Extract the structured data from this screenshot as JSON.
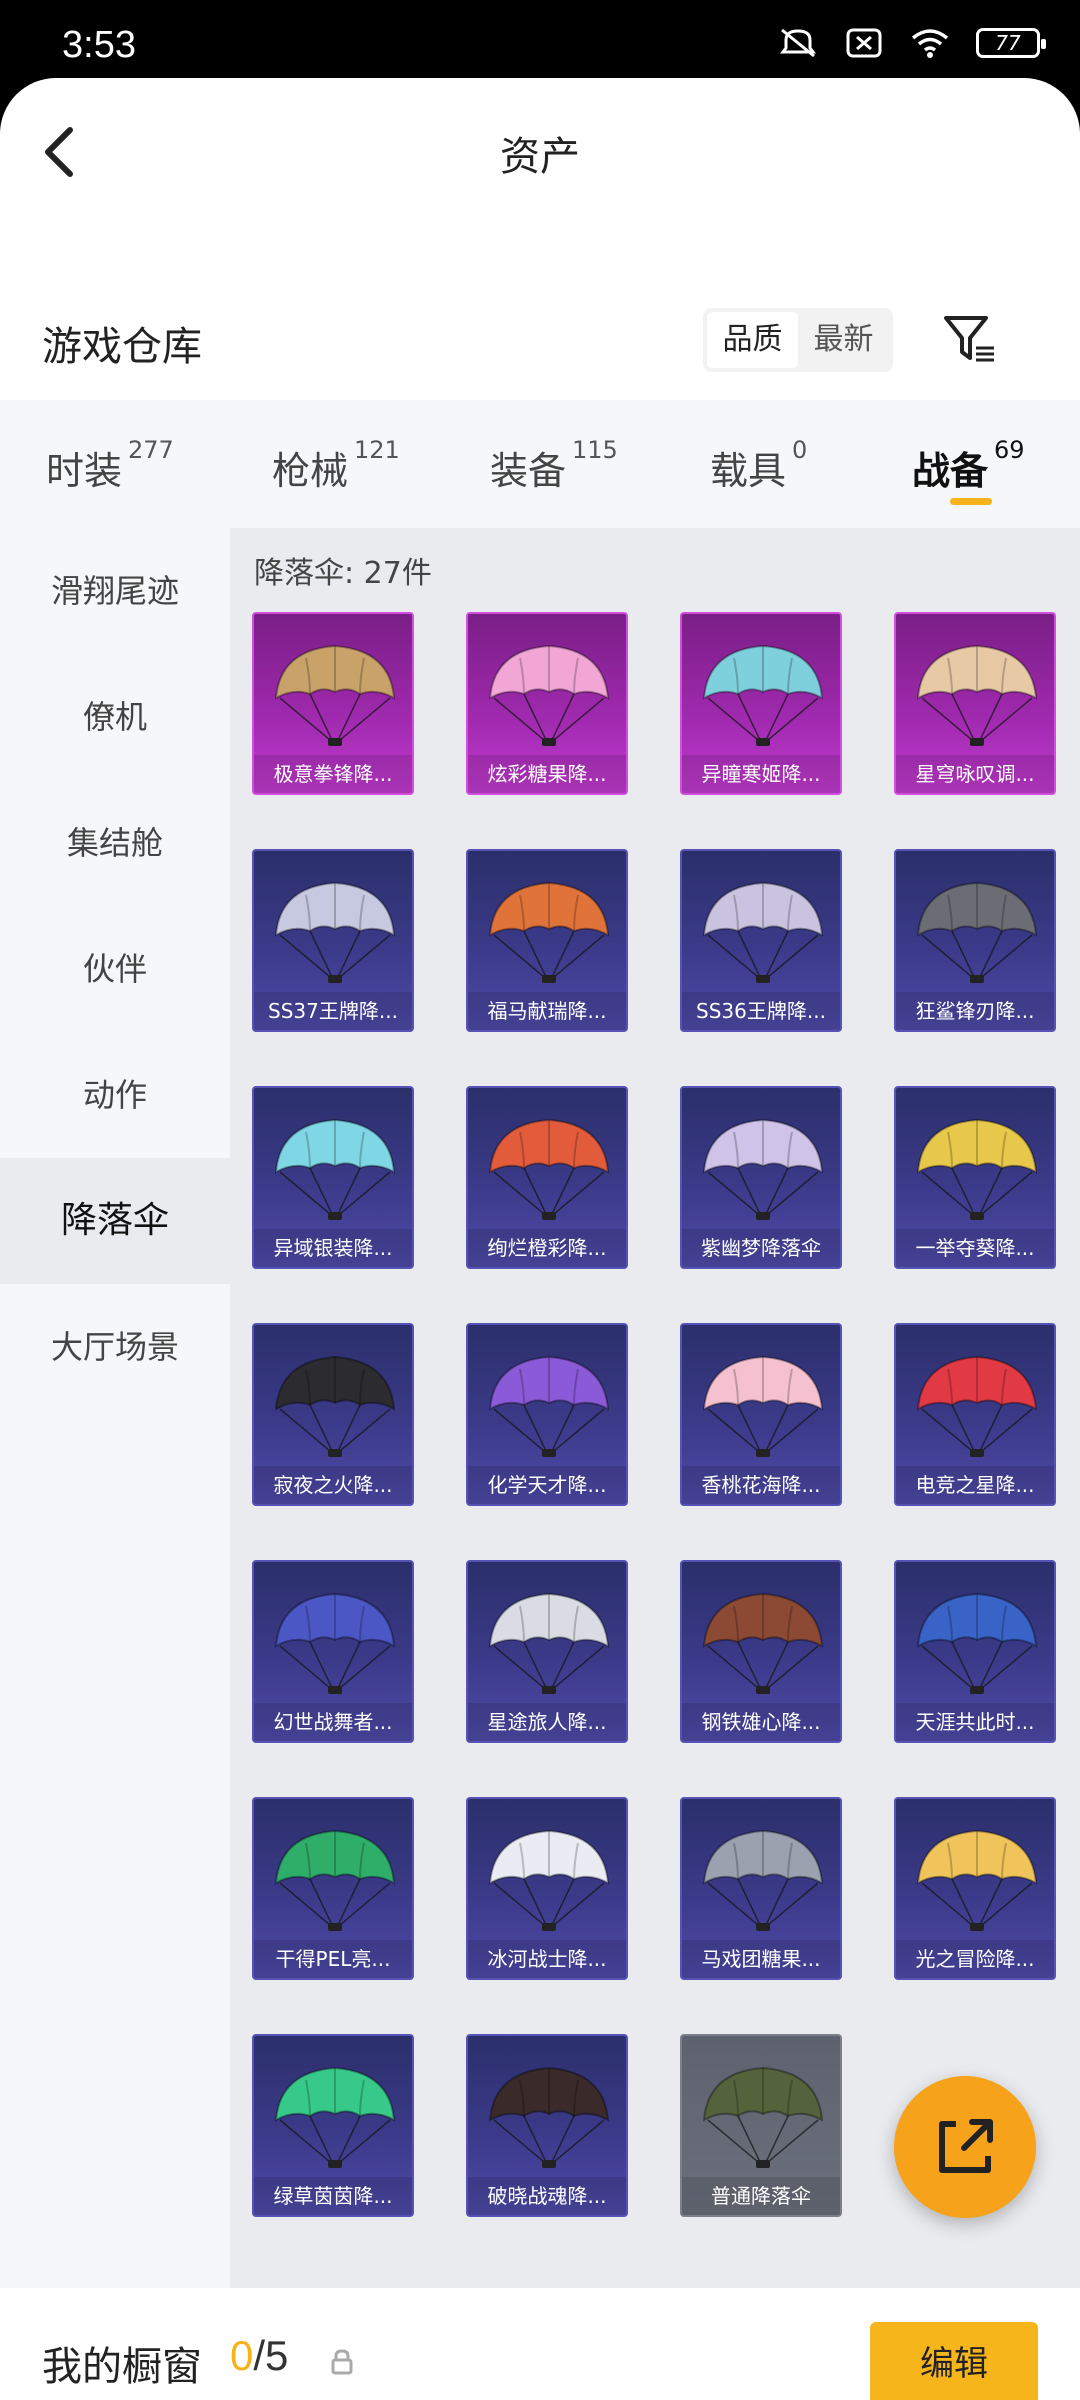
{
  "status_bar": {
    "time": "3:53",
    "battery": "77"
  },
  "header": {
    "title": "资产"
  },
  "warehouse": {
    "title": "游戏仓库",
    "sort_options": [
      "品质",
      "最新"
    ]
  },
  "tabs": [
    {
      "label": "时装",
      "count": "277"
    },
    {
      "label": "枪械",
      "count": "121"
    },
    {
      "label": "装备",
      "count": "115"
    },
    {
      "label": "载具",
      "count": "0"
    },
    {
      "label": "战备",
      "count": "69"
    }
  ],
  "side_menu": [
    "滑翔尾迹",
    "僚机",
    "集结舱",
    "伙伴",
    "动作",
    "降落伞",
    "大厅场景"
  ],
  "grid": {
    "header": "降落伞: 27件",
    "items": [
      {
        "name": "极意拳锋降...",
        "rarity": "legend",
        "color": "#c9a26a"
      },
      {
        "name": "炫彩糖果降...",
        "rarity": "legend",
        "color": "#f2a6d6"
      },
      {
        "name": "异瞳寒姬降...",
        "rarity": "legend",
        "color": "#7fd0dd"
      },
      {
        "name": "星穹咏叹调...",
        "rarity": "legend",
        "color": "#e8c9a6"
      },
      {
        "name": "SS37王牌降...",
        "rarity": "epic",
        "color": "#c7c9e0"
      },
      {
        "name": "福马献瑞降...",
        "rarity": "epic",
        "color": "#e0733a"
      },
      {
        "name": "SS36王牌降...",
        "rarity": "epic",
        "color": "#c9c3df"
      },
      {
        "name": "狂鲨锋刃降...",
        "rarity": "epic",
        "color": "#6a6d73"
      },
      {
        "name": "异域银装降...",
        "rarity": "epic",
        "color": "#7fd7e6"
      },
      {
        "name": "绚烂橙彩降...",
        "rarity": "epic",
        "color": "#e25c3c"
      },
      {
        "name": "紫幽梦降落伞",
        "rarity": "epic",
        "color": "#cfc3e8"
      },
      {
        "name": "一举夺葵降...",
        "rarity": "epic",
        "color": "#e8c84a"
      },
      {
        "name": "寂夜之火降...",
        "rarity": "epic",
        "color": "#2c2c30"
      },
      {
        "name": "化学天才降...",
        "rarity": "epic",
        "color": "#8a5ad8"
      },
      {
        "name": "香桃花海降...",
        "rarity": "epic",
        "color": "#f6c1cf"
      },
      {
        "name": "电竞之星降...",
        "rarity": "epic",
        "color": "#e23a44"
      },
      {
        "name": "幻世战舞者...",
        "rarity": "epic",
        "color": "#4c57c6"
      },
      {
        "name": "星途旅人降...",
        "rarity": "epic",
        "color": "#d9dde3"
      },
      {
        "name": "钢铁雄心降...",
        "rarity": "epic",
        "color": "#8c4a34"
      },
      {
        "name": "天涯共此时...",
        "rarity": "epic",
        "color": "#3a63c8"
      },
      {
        "name": "干得PEL亮...",
        "rarity": "epic",
        "color": "#2fae6a"
      },
      {
        "name": "冰河战士降...",
        "rarity": "epic",
        "color": "#e9edf3"
      },
      {
        "name": "马戏团糖果...",
        "rarity": "epic",
        "color": "#9aa2b0"
      },
      {
        "name": "光之冒险降...",
        "rarity": "epic",
        "color": "#f0c45a"
      },
      {
        "name": "绿草茵茵降...",
        "rarity": "epic",
        "color": "#36c98a"
      },
      {
        "name": "破晓战魂降...",
        "rarity": "epic",
        "color": "#3a2a2a"
      },
      {
        "name": "普通降落伞",
        "rarity": "plain",
        "color": "#55633c"
      }
    ]
  },
  "bottom": {
    "showcase_title": "我的橱窗",
    "showcase_current": "0",
    "showcase_total": "/5",
    "edit_label": "编辑"
  }
}
